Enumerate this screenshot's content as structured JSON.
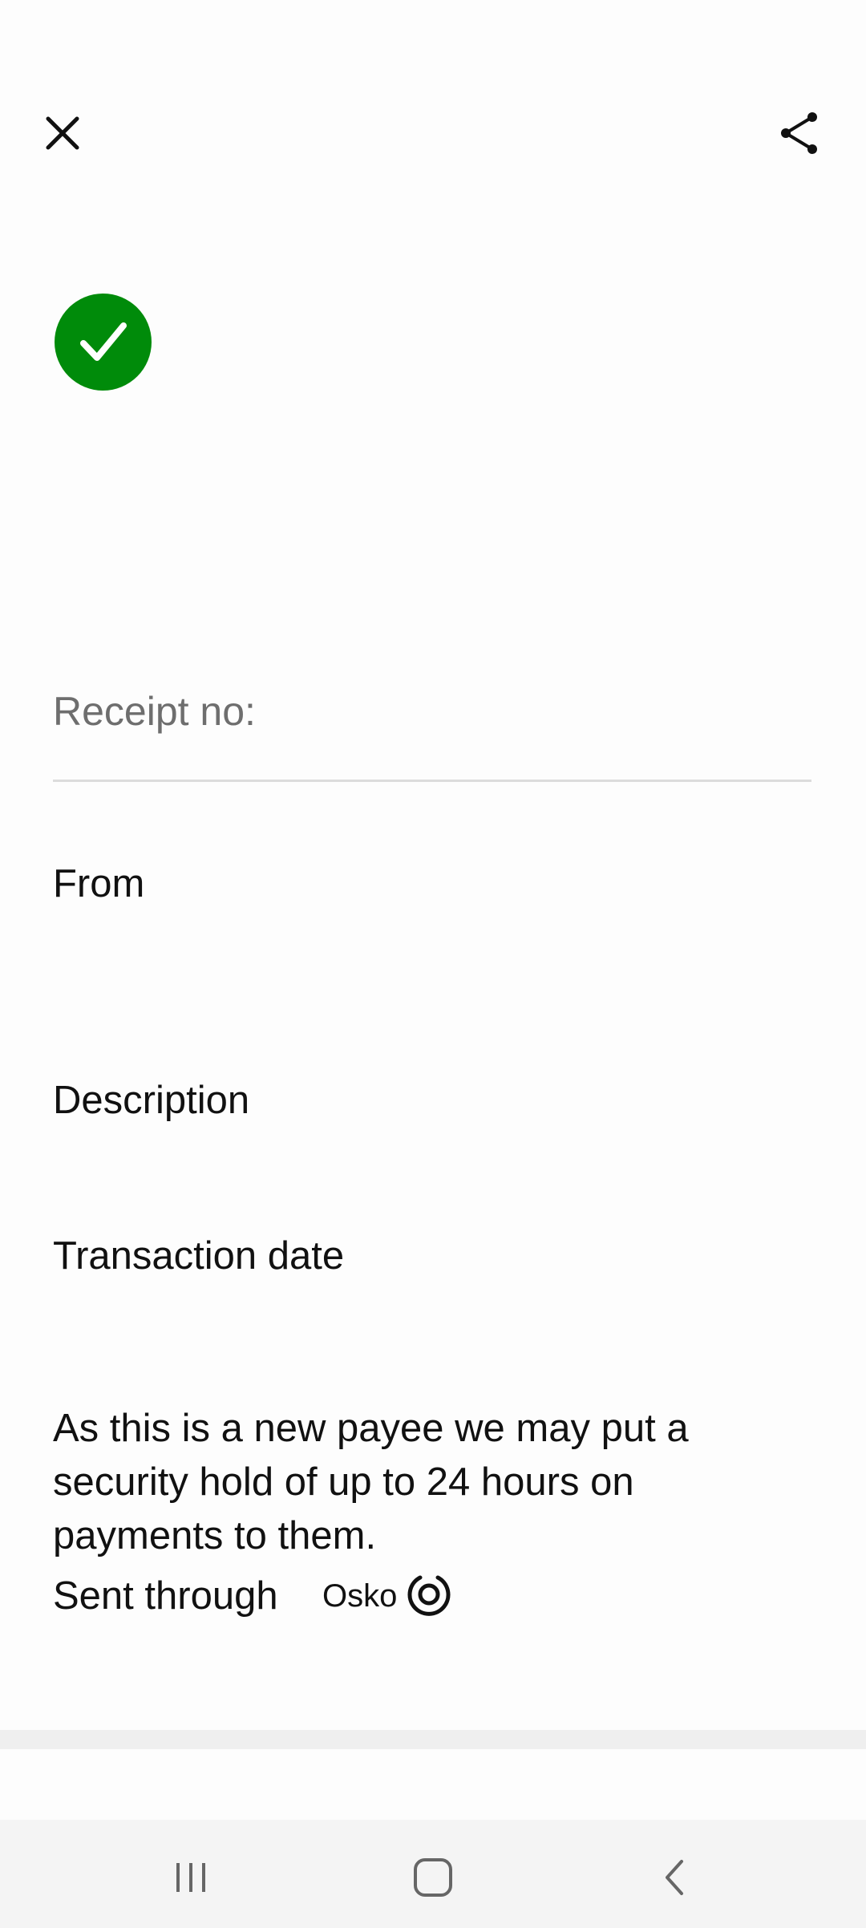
{
  "receipt": {
    "receipt_label": "Receipt no:",
    "from_label": "From",
    "description_label": "Description",
    "transaction_date_label": "Transaction date",
    "new_payee_notice": "As this is a new payee we may put a security hold of up to 24 hours on payments to them.",
    "sent_through_label": "Sent through",
    "payment_network": "Osko"
  },
  "colors": {
    "success_green": "#008b0a",
    "secondary_text": "#6e6e6e",
    "divider": "#dcdcdc",
    "navbar_bg": "#f4f4f4"
  },
  "icons": {
    "close": "close-icon",
    "share": "share-icon",
    "success": "checkmark-icon",
    "osko": "osko-logo-icon",
    "recents": "recents-icon",
    "home": "home-icon",
    "back": "back-icon"
  }
}
